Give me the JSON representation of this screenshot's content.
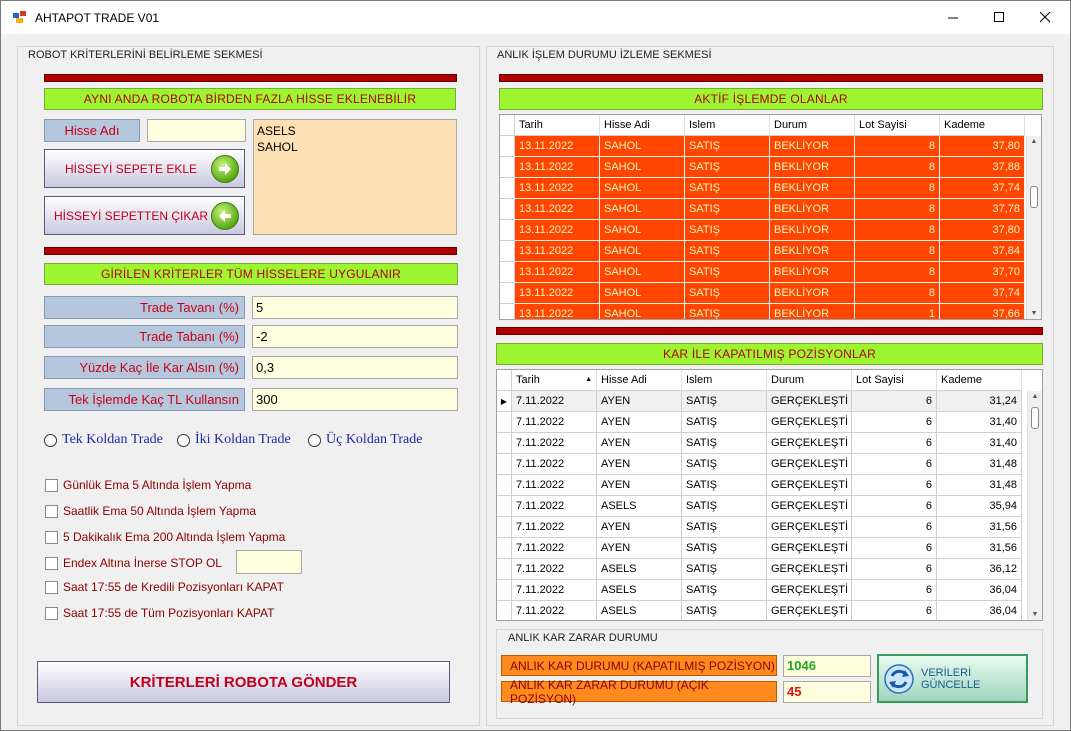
{
  "window": {
    "title": "AHTAPOT TRADE V01"
  },
  "left": {
    "group_title": "ROBOT KRİTERLERİNİ BELİRLEME SEKMESİ",
    "multi_stock_header": "AYNI ANDA ROBOTA BİRDEN FAZLA HİSSE EKLENEBİLİR",
    "stock_name_label": "Hisse Adı",
    "stock_name_value": "",
    "add_button": "HİSSEYİ SEPETE EKLE",
    "remove_button": "HİSSEYİ SEPETTEN ÇIKAR",
    "basket": [
      "ASELS",
      "SAHOL"
    ],
    "criteria_header": "GİRİLEN KRİTERLER TÜM HİSSELERE UYGULANIR",
    "fields": [
      {
        "label": "Trade Tavanı (%)",
        "value": "5"
      },
      {
        "label": "Trade Tabanı (%)",
        "value": "-2"
      },
      {
        "label": "Yüzde Kaç İle Kar Alsın (%)",
        "value": "0,3"
      },
      {
        "label": "Tek İşlemde Kaç TL Kullansın",
        "value": "300"
      }
    ],
    "radios": [
      "Tek Koldan Trade",
      "İki Koldan Trade",
      "Üç Koldan Trade"
    ],
    "checks": [
      "Günlük Ema 5 Altında İşlem Yapma",
      "Saatlik Ema 50 Altında İşlem Yapma",
      "5 Dakikalık Ema 200 Altında İşlem Yapma",
      "Endex Altına İnerse STOP OL",
      "Saat 17:55 de Kredili Pozisyonları KAPAT",
      "Saat 17:55 de Tüm Pozisyonları KAPAT"
    ],
    "stop_value": "",
    "send_button": "KRİTERLERİ ROBOTA GÖNDER"
  },
  "right": {
    "group_title": "ANLIK İŞLEM DURUMU İZLEME SEKMESİ",
    "active_header": "AKTİF İŞLEMDE OLANLAR",
    "columns": [
      "Tarih",
      "Hisse Adi",
      "Islem",
      "Durum",
      "Lot Sayisi",
      "Kademe"
    ],
    "active_rows": [
      [
        "13.11.2022",
        "SAHOL",
        "SATIŞ",
        "BEKLİYOR",
        "8",
        "37,80"
      ],
      [
        "13.11.2022",
        "SAHOL",
        "SATIŞ",
        "BEKLİYOR",
        "8",
        "37,88"
      ],
      [
        "13.11.2022",
        "SAHOL",
        "SATIŞ",
        "BEKLİYOR",
        "8",
        "37,74"
      ],
      [
        "13.11.2022",
        "SAHOL",
        "SATIŞ",
        "BEKLİYOR",
        "8",
        "37,78"
      ],
      [
        "13.11.2022",
        "SAHOL",
        "SATIŞ",
        "BEKLİYOR",
        "8",
        "37,80"
      ],
      [
        "13.11.2022",
        "SAHOL",
        "SATIŞ",
        "BEKLİYOR",
        "8",
        "37,84"
      ],
      [
        "13.11.2022",
        "SAHOL",
        "SATIŞ",
        "BEKLİYOR",
        "8",
        "37,70"
      ],
      [
        "13.11.2022",
        "SAHOL",
        "SATIŞ",
        "BEKLİYOR",
        "8",
        "37,74"
      ],
      [
        "13.11.2022",
        "SAHOL",
        "SATIŞ",
        "BEKLİYOR",
        "1",
        "37,66"
      ]
    ],
    "closed_header": "KAR İLE KAPATILMIŞ POZİSYONLAR",
    "closed_rows": [
      [
        "7.11.2022",
        "AYEN",
        "SATIŞ",
        "GERÇEKLEŞTİ",
        "6",
        "31,24"
      ],
      [
        "7.11.2022",
        "AYEN",
        "SATIŞ",
        "GERÇEKLEŞTİ",
        "6",
        "31,40"
      ],
      [
        "7.11.2022",
        "AYEN",
        "SATIŞ",
        "GERÇEKLEŞTİ",
        "6",
        "31,40"
      ],
      [
        "7.11.2022",
        "AYEN",
        "SATIŞ",
        "GERÇEKLEŞTİ",
        "6",
        "31,48"
      ],
      [
        "7.11.2022",
        "AYEN",
        "SATIŞ",
        "GERÇEKLEŞTİ",
        "6",
        "31,48"
      ],
      [
        "7.11.2022",
        "ASELS",
        "SATIŞ",
        "GERÇEKLEŞTİ",
        "6",
        "35,94"
      ],
      [
        "7.11.2022",
        "AYEN",
        "SATIŞ",
        "GERÇEKLEŞTİ",
        "6",
        "31,56"
      ],
      [
        "7.11.2022",
        "AYEN",
        "SATIŞ",
        "GERÇEKLEŞTİ",
        "6",
        "31,56"
      ],
      [
        "7.11.2022",
        "ASELS",
        "SATIŞ",
        "GERÇEKLEŞTİ",
        "6",
        "36,12"
      ],
      [
        "7.11.2022",
        "ASELS",
        "SATIŞ",
        "GERÇEKLEŞTİ",
        "6",
        "36,04"
      ],
      [
        "7.11.2022",
        "ASELS",
        "SATIŞ",
        "GERÇEKLEŞTİ",
        "6",
        "36,04"
      ]
    ],
    "pnl_group_title": "ANLIK KAR ZARAR DURUMU",
    "realized_label": "ANLIK KAR DURUMU (KAPATILMIŞ POZİSYON)",
    "realized_value": "1046",
    "unrealized_label": "ANLIK KAR ZARAR DURUMU (AÇIK POZİSYON)",
    "unrealized_value": "45",
    "refresh_button": "VERİLERİ GÜNCELLE"
  },
  "colors": {
    "active_row": "#ff4500",
    "header_green": "#9cf52e",
    "accent_red": "#b10000",
    "orange": "#ff8a1e"
  }
}
